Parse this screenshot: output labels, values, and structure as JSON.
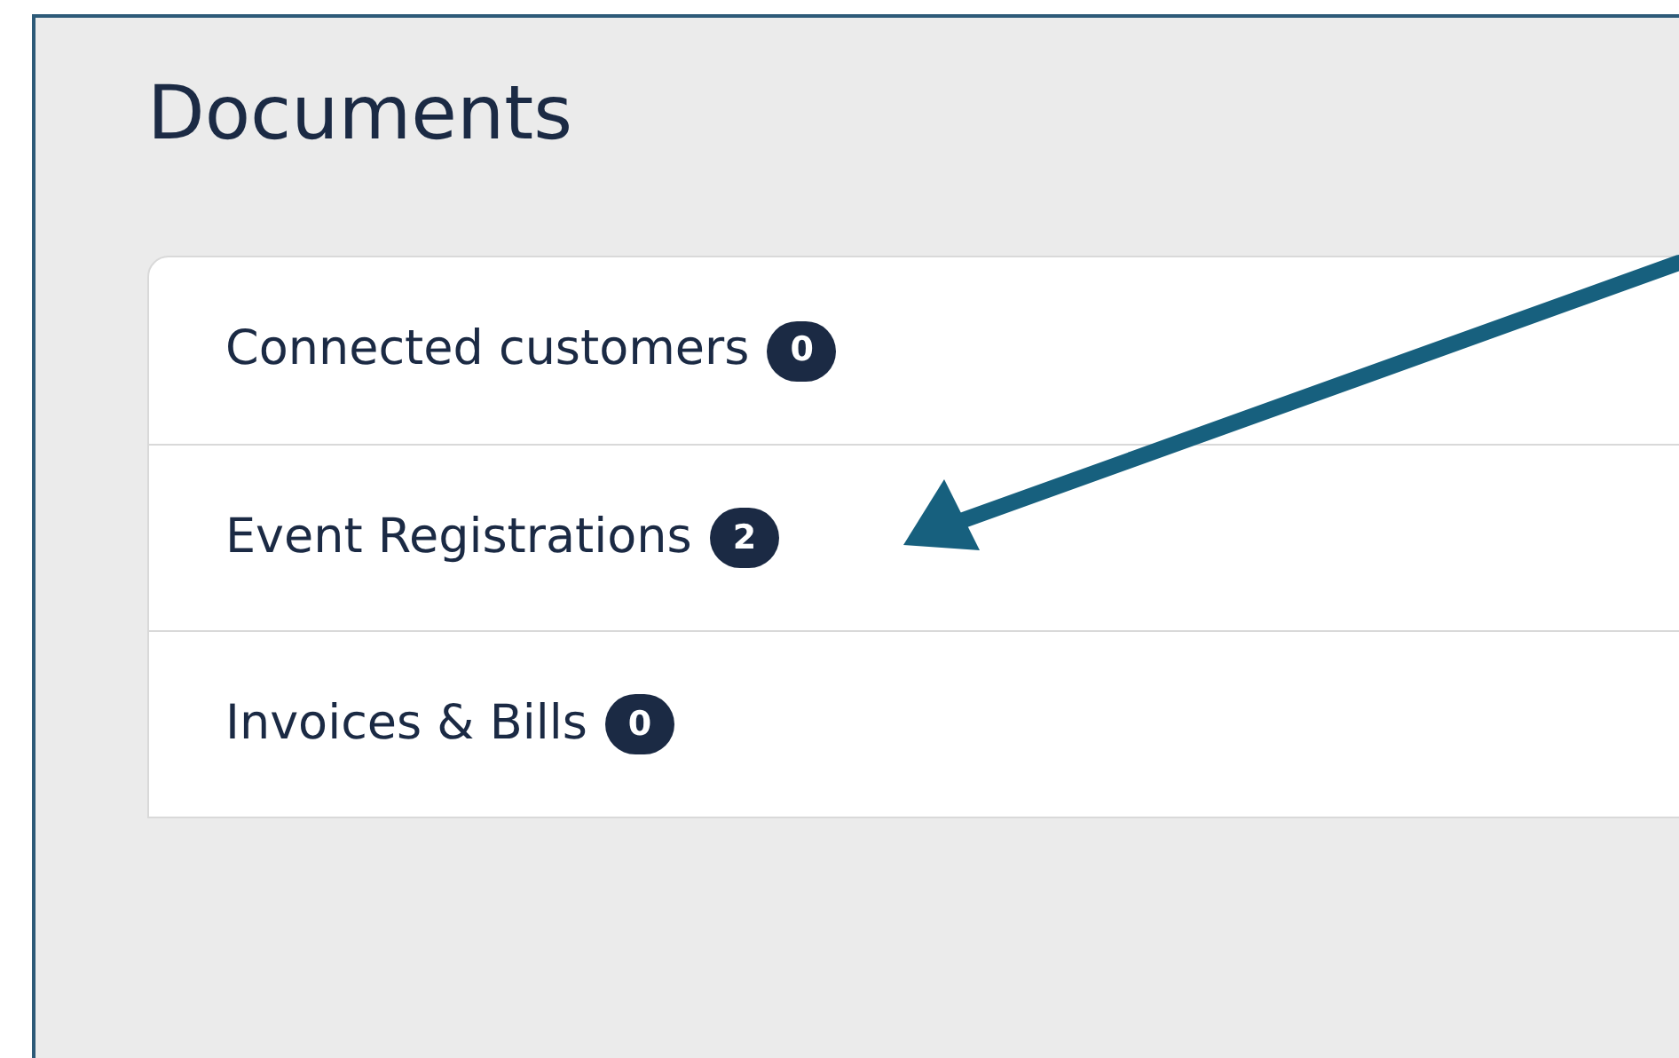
{
  "title": "Documents",
  "items": [
    {
      "label": "Connected customers",
      "count": "0"
    },
    {
      "label": "Event Registrations",
      "count": "2"
    },
    {
      "label": "Invoices & Bills",
      "count": "0"
    }
  ]
}
